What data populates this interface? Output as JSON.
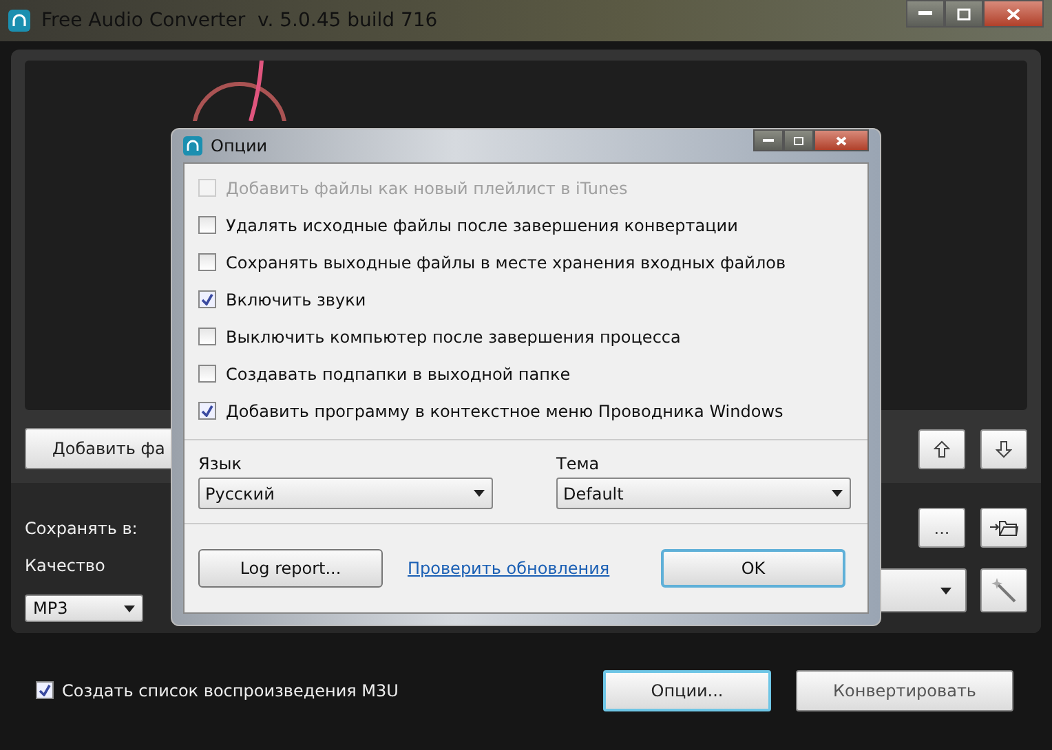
{
  "window": {
    "title": "Free Audio Converter  v. 5.0.45 build 716"
  },
  "main": {
    "add_button": "Добавить фа",
    "save_label": "Сохранять в:",
    "browse_button": "...",
    "quality_label": "Качество",
    "format_select": "MP3",
    "playlist_checkbox": {
      "label": "Создать список воспроизведения M3U",
      "checked": true
    },
    "options_button": "Опции...",
    "convert_button": "Конвертировать"
  },
  "dialog": {
    "title": "Опции",
    "options": [
      {
        "label": "Добавить файлы как новый плейлист в iTunes",
        "checked": false,
        "disabled": true
      },
      {
        "label": "Удалять исходные файлы после завершения конвертации",
        "checked": false,
        "disabled": false
      },
      {
        "label": "Сохранять выходные файлы в месте хранения входных файлов",
        "checked": false,
        "disabled": false
      },
      {
        "label": "Включить звуки",
        "checked": true,
        "disabled": false
      },
      {
        "label": "Выключить компьютер после завершения процесса",
        "checked": false,
        "disabled": false
      },
      {
        "label": "Создавать подпапки в выходной папке",
        "checked": false,
        "disabled": false
      },
      {
        "label": "Добавить программу в контекстное меню Проводника Windows",
        "checked": true,
        "disabled": false
      }
    ],
    "language": {
      "label": "Язык",
      "value": "Русский"
    },
    "theme": {
      "label": "Тема",
      "value": "Default"
    },
    "log_button": "Log report...",
    "update_link": "Проверить обновления",
    "ok_button": "OK"
  }
}
